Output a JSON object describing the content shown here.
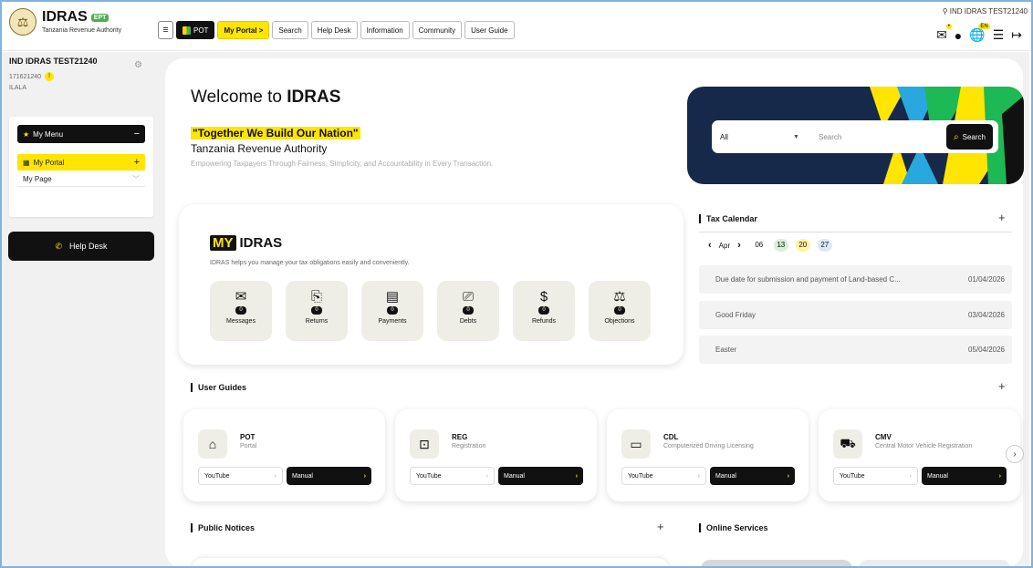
{
  "app": {
    "logo_title": "IDRAS",
    "logo_badge": "EPT",
    "logo_subtitle": "Tanzania Revenue Authority"
  },
  "nav": {
    "items": [
      "POT",
      "My Portal >",
      "Search",
      "Help Desk",
      "Information",
      "Community",
      "User Guide"
    ]
  },
  "topbar": {
    "user_label": "IND IDRAS TEST21240",
    "lang_badge": "EN"
  },
  "sidebar": {
    "user_name": "IND IDRAS TEST21240",
    "user_id": "171621240",
    "warn_badge": "!",
    "user_location": "ILALA",
    "my_menu_label": "My Menu",
    "my_portal_label": "My Portal",
    "my_page_label": "My Page",
    "helpdesk_label": "Help Desk"
  },
  "hero": {
    "welcome_prefix": "Welcome to ",
    "welcome_brand": "IDRAS",
    "slogan": "\"Together We Build Our Nation\"",
    "org": "Tanzania Revenue Authority",
    "tagline": "Empowering Taxpayers Through Fairness, Simplicity, and Accountability in Every Transaction."
  },
  "search": {
    "scope_value": "All",
    "placeholder": "Search",
    "button_label": "Search"
  },
  "my_idras": {
    "logo": "MY",
    "title": "IDRAS",
    "description": "IDRAS helps you manage your tax obligations easily and conveniently.",
    "tiles": [
      {
        "label": "Messages",
        "count": "0",
        "icon": "mail-icon"
      },
      {
        "label": "Returns",
        "count": "0",
        "icon": "returns-icon"
      },
      {
        "label": "Payments",
        "count": "0",
        "icon": "payments-icon"
      },
      {
        "label": "Debts",
        "count": "0",
        "icon": "debts-icon"
      },
      {
        "label": "Refunds",
        "count": "0",
        "icon": "refunds-icon"
      },
      {
        "label": "Objections",
        "count": "0",
        "icon": "objections-icon"
      }
    ]
  },
  "tax_calendar": {
    "title": "Tax Calendar",
    "month": "Apr",
    "days": [
      "06",
      "13",
      "20",
      "27"
    ],
    "events": [
      {
        "title": "Due date for submission and payment of Land-based C...",
        "date": "01/04/2026"
      },
      {
        "title": "Good Friday",
        "date": "03/04/2026"
      },
      {
        "title": "Easter",
        "date": "05/04/2026"
      }
    ]
  },
  "user_guides": {
    "title": "User Guides",
    "youtube_label": "YouTube",
    "manual_label": "Manual",
    "items": [
      {
        "code": "POT",
        "name": "Portal",
        "icon": "home-icon"
      },
      {
        "code": "REG",
        "name": "Registration",
        "icon": "id-card-icon"
      },
      {
        "code": "CDL",
        "name": "Computerized Driving Licensing",
        "icon": "license-icon"
      },
      {
        "code": "CMV",
        "name": "Central Motor Vehicle Registration",
        "icon": "vehicle-icon"
      }
    ]
  },
  "public_notices": {
    "title": "Public Notices"
  },
  "online_services": {
    "title": "Online Services"
  },
  "colors": {
    "accent_yellow": "#ffe500",
    "dark": "#111111",
    "banner_navy": "#17294a",
    "banner_blue": "#29a8e0",
    "banner_green": "#1db954"
  }
}
